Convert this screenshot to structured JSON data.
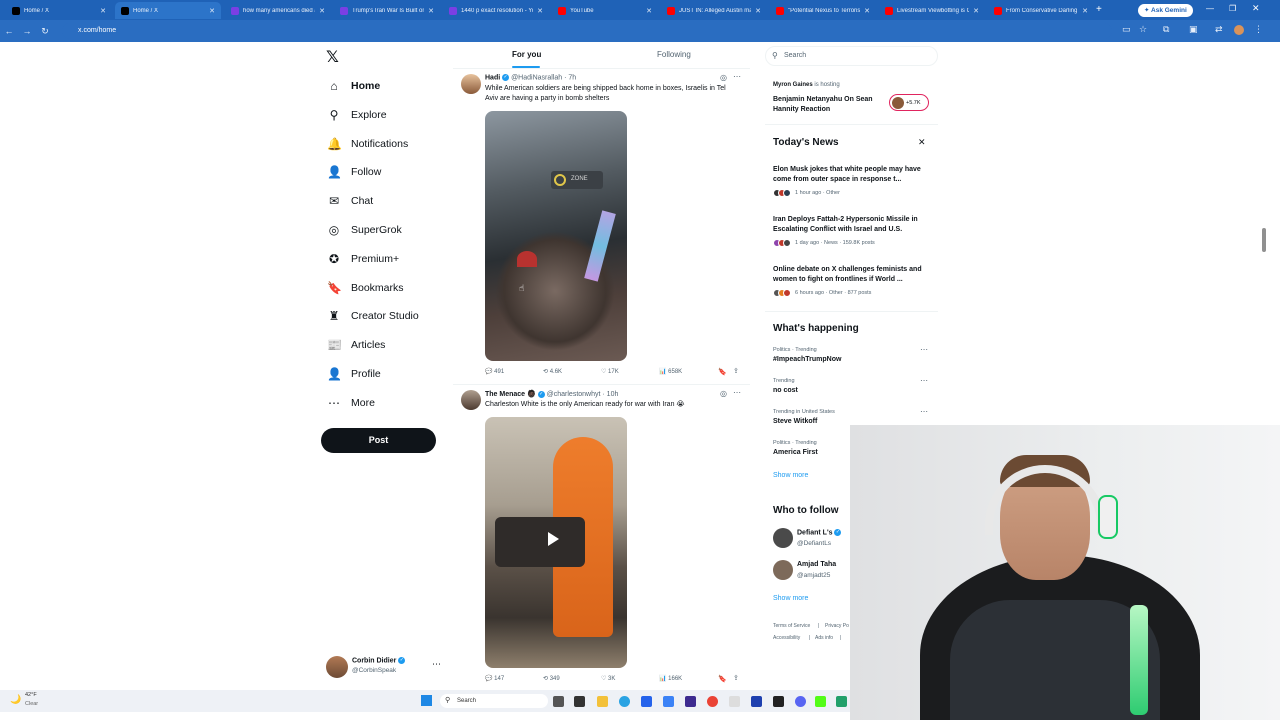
{
  "browser": {
    "tabs": [
      {
        "title": "Home / X",
        "active": false,
        "color": "#000000"
      },
      {
        "title": "Home / X",
        "active": true,
        "color": "#000000"
      },
      {
        "title": "how many americans died a",
        "active": false,
        "color": "#7b3fe4"
      },
      {
        "title": "Trump's Iran War Is Built on",
        "active": false,
        "color": "#7b3fe4"
      },
      {
        "title": "1440 p exact resolution - Yo",
        "active": false,
        "color": "#7b3fe4"
      },
      {
        "title": "YouTube",
        "active": false,
        "color": "#ff0000"
      },
      {
        "title": "JUST IN: Alleged Austin ma",
        "active": false,
        "color": "#ff0000"
      },
      {
        "title": "\"Potential Nexus to Terroris",
        "active": false,
        "color": "#ff0000"
      },
      {
        "title": "Livestream Viewbotting is G",
        "active": false,
        "color": "#ff0000"
      },
      {
        "title": "From Conservative Darling",
        "active": false,
        "color": "#ff0000"
      }
    ],
    "new_tab": "+",
    "ask_gemini": "Ask Gemini",
    "url": "x.com/home"
  },
  "nav": {
    "items": [
      {
        "label": "Home",
        "icon": "home-icon",
        "glyph": "⌂"
      },
      {
        "label": "Explore",
        "icon": "search-icon",
        "glyph": "⚲"
      },
      {
        "label": "Notifications",
        "icon": "bell-icon",
        "glyph": "🔔"
      },
      {
        "label": "Follow",
        "icon": "person-add-icon",
        "glyph": "👤"
      },
      {
        "label": "Chat",
        "icon": "mail-icon",
        "glyph": "✉"
      },
      {
        "label": "SuperGrok",
        "icon": "grok-icon",
        "glyph": "◎"
      },
      {
        "label": "Premium+",
        "icon": "premium-icon",
        "glyph": "✪"
      },
      {
        "label": "Bookmarks",
        "icon": "bookmark-icon",
        "glyph": "🔖"
      },
      {
        "label": "Creator Studio",
        "icon": "creator-icon",
        "glyph": "♜"
      },
      {
        "label": "Articles",
        "icon": "article-icon",
        "glyph": "📰"
      },
      {
        "label": "Profile",
        "icon": "profile-icon",
        "glyph": "👤"
      },
      {
        "label": "More",
        "icon": "more-circle-icon",
        "glyph": "⋯"
      }
    ],
    "post_label": "Post",
    "account": {
      "name": "Corbin Didier",
      "handle": "@CorbinSpeak"
    }
  },
  "feed": {
    "tabs": [
      "For you",
      "Following"
    ],
    "tweets": [
      {
        "name": "Hadi",
        "handle": "@HadiNasrallah",
        "time": "· 7h",
        "text": "While American soldiers are being shipped back home in boxes, Israelis in Tel Aviv are having a party in bomb shelters",
        "replies": "491",
        "reposts": "4.6K",
        "likes": "17K",
        "views": "658K",
        "sign_text": "ZONE"
      },
      {
        "name": "The Menace",
        "handle": "@charlestonwhyt",
        "time": "· 10h",
        "text": "Charleston White is the only American ready for war with Iran 😭",
        "replies": "147",
        "reposts": "349",
        "likes": "3K",
        "views": "166K"
      }
    ]
  },
  "sidebar": {
    "search_placeholder": "Search",
    "space": {
      "host": "Myron Gaines",
      "host_suffix": "is hosting",
      "title": "Benjamin Netanyahu On Sean Hannity Reaction",
      "listeners": "+5.7K"
    },
    "news_title": "Today's News",
    "news": [
      {
        "headline": "Elon Musk jokes that white people may have come from outer space in response t...",
        "meta": "1 hour ago · Other"
      },
      {
        "headline": "Iran Deploys Fattah-2 Hypersonic Missile in Escalating Conflict with Israel and U.S.",
        "meta": "1 day ago · News · 159.8K posts"
      },
      {
        "headline": "Online debate on X challenges feminists and women to fight on frontlines if World ...",
        "meta": "6 hours ago · Other · 877 posts"
      }
    ],
    "happening_title": "What's happening",
    "trends": [
      {
        "category": "Politics · Trending",
        "name": "#ImpeachTrumpNow"
      },
      {
        "category": "Trending",
        "name": "no cost"
      },
      {
        "category": "Trending in United States",
        "name": "Steve Witkoff"
      },
      {
        "category": "Politics · Trending",
        "name": "America First"
      }
    ],
    "show_more": "Show more",
    "follow_title": "Who to follow",
    "follow": [
      {
        "name": "Defiant L's",
        "handle": "@DefiantLs"
      },
      {
        "name": "Amjad Taha",
        "handle": "@amjadt25"
      }
    ],
    "follow_show_more": "Show more",
    "footer": [
      "Terms of Service",
      "|",
      "Privacy Po",
      "Accessibility",
      "|",
      "Ads info",
      "|"
    ]
  },
  "taskbar": {
    "weather_temp": "42°F",
    "weather_desc": "Clear",
    "search_placeholder": "Search"
  },
  "colors": {
    "accent": "#1d9bf0",
    "browser_bar": "#1f62b7",
    "post_button": "#0f1419"
  }
}
